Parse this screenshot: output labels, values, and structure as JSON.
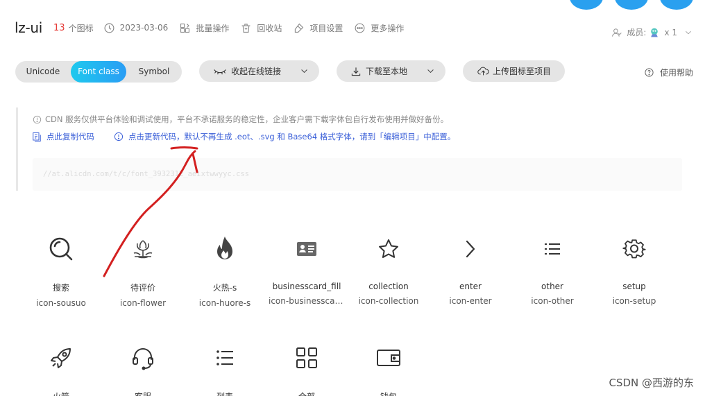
{
  "header": {
    "title": "lz-ui",
    "icon_count": "13",
    "icon_count_label": "个图标",
    "date": "2023-03-06",
    "batch_ops": "批量操作",
    "recycle_bin": "回收站",
    "project_settings": "项目设置",
    "more_ops": "更多操作",
    "members_label": "成员:",
    "members_count": "x 1"
  },
  "toolbar": {
    "tabs": [
      {
        "label": "Unicode"
      },
      {
        "label": "Font class"
      },
      {
        "label": "Symbol"
      }
    ],
    "active_tab": "Font class",
    "embed_label": "收起在线链接",
    "download_label": "下载至本地",
    "upload_label": "上传图标至项目",
    "help_label": "使用帮助"
  },
  "cdn": {
    "notice": "CDN 服务仅供平台体验和调试使用，平台不承诺服务的稳定性，企业客户需下载字体包自行发布使用并做好备份。",
    "copy_label": "点此复制代码",
    "update_label": "点击更新代码，默认不再生成 .eot、.svg 和 Base64 格式字体，请到「编辑项目」中配置。",
    "url": "//at.alicdn.com/t/c/font_3932312_aeixtwwyyc.css"
  },
  "icons": [
    {
      "name": "搜索",
      "class": "icon-sousuo",
      "glyph": "search-icon"
    },
    {
      "name": "待评价",
      "class": "icon-flower",
      "glyph": "flower-icon"
    },
    {
      "name": "火热-s",
      "class": "icon-huore-s",
      "glyph": "flame-icon"
    },
    {
      "name": "businesscard_fill",
      "class": "icon-businesscar...",
      "glyph": "business-card-icon"
    },
    {
      "name": "collection",
      "class": "icon-collection",
      "glyph": "star-icon"
    },
    {
      "name": "enter",
      "class": "icon-enter",
      "glyph": "chevron-right-icon"
    },
    {
      "name": "other",
      "class": "icon-other",
      "glyph": "list-icon"
    },
    {
      "name": "setup",
      "class": "icon-setup",
      "glyph": "gear-icon"
    },
    {
      "name": "火箭",
      "class": "",
      "glyph": "rocket-icon"
    },
    {
      "name": "客服",
      "class": "",
      "glyph": "headset-icon"
    },
    {
      "name": "列表",
      "class": "",
      "glyph": "list-bullets-icon"
    },
    {
      "name": "全部",
      "class": "",
      "glyph": "grid-icon"
    },
    {
      "name": "钱包",
      "class": "",
      "glyph": "wallet-icon"
    }
  ],
  "watermark": "CSDN @西游的东",
  "colors": {
    "accent_start": "#1ec9ee",
    "accent_end": "#2a9df4",
    "count_red": "#e53935",
    "link_blue": "#3a5fd8",
    "annotation_red": "#d32020"
  }
}
